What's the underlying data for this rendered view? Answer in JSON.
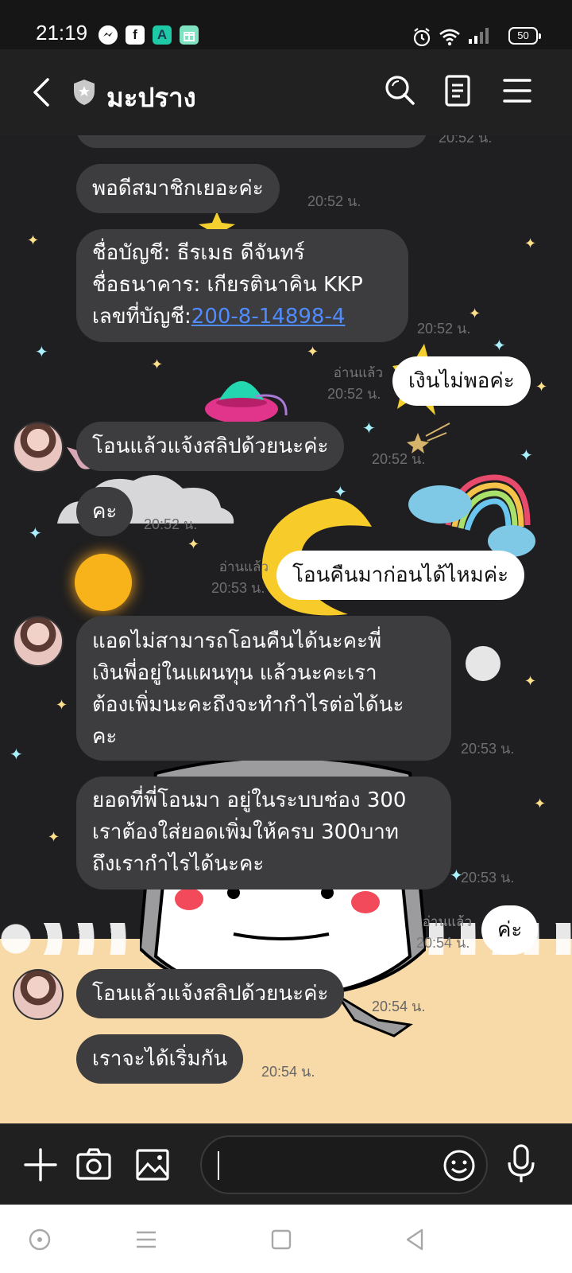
{
  "status_bar": {
    "time": "21:19",
    "battery": "50",
    "app_icons": [
      "messenger-icon",
      "facebook-icon",
      "a-app-icon",
      "gift-app-icon"
    ],
    "icon_letters": {
      "facebook": "f",
      "a_app": "A"
    }
  },
  "header": {
    "title": "มะปราง"
  },
  "messages": [
    {
      "id": "m1",
      "side": "in",
      "text": "พอดีสมาชิกเยอะค่ะ",
      "time": "20:52 น."
    },
    {
      "id": "m2",
      "side": "in",
      "lines": [
        "ชื่อบัญชี:  ธีรเมธ ดีจันทร์",
        "ชื่อธนาคาร: เกียรตินาคิน KKP"
      ],
      "account_label": "เลขที่บัญชี:",
      "account_number": "200-8-14898-4",
      "time": "20:52 น."
    },
    {
      "id": "m3",
      "side": "out",
      "text": "เงินไม่พอค่ะ",
      "read": "อ่านแล้ว",
      "time": "20:52 น."
    },
    {
      "id": "m4",
      "side": "in",
      "text": "โอนแล้วแจ้งสลิปด้วยนะค่ะ",
      "time": "20:52 น."
    },
    {
      "id": "m5",
      "side": "in",
      "text": "คะ",
      "time": "20:52 น."
    },
    {
      "id": "m6",
      "side": "out",
      "text": "โอนคืนมาก่อนได้ไหมค่ะ",
      "read": "อ่านแล้ว",
      "time": "20:53 น."
    },
    {
      "id": "m7",
      "side": "in",
      "lines": [
        "แอดไม่สามารถโอนคืนได้นะคะพี่",
        "เงินพี่อยู่ในแผนทุน แล้วนะคะเรา",
        "ต้องเพิ่มนะคะถึงจะทำกำไรต่อได้นะ",
        "คะ"
      ],
      "time": "20:53 น."
    },
    {
      "id": "m8",
      "side": "in",
      "lines": [
        "ยอดที่พี่โอนมา อยู่ในระบบช่อง 300",
        "เราต้องใส่ยอดเพิ่มให้ครบ 300บาท",
        "ถึงเรากำไรได้นะคะ"
      ],
      "time": "20:53 น."
    },
    {
      "id": "m9",
      "side": "out",
      "text": "ค่ะ",
      "read": "อ่านแล้ว",
      "time": "20:54 น."
    },
    {
      "id": "m10",
      "side": "in",
      "text": "โอนแล้วแจ้งสลิปด้วยนะค่ะ",
      "time": "20:54 น."
    },
    {
      "id": "m11",
      "side": "in",
      "text": "เราจะได้เริ่มกัน",
      "time": "20:54 น."
    }
  ],
  "previous_message_time": "20:52 น.",
  "input": {
    "placeholder": ""
  },
  "colors": {
    "bubble_in": "#3d3c3e",
    "bubble_out": "#ffffff",
    "background": "#1f1e20",
    "link": "#4f8cff",
    "sand": "#f8d9a8"
  }
}
